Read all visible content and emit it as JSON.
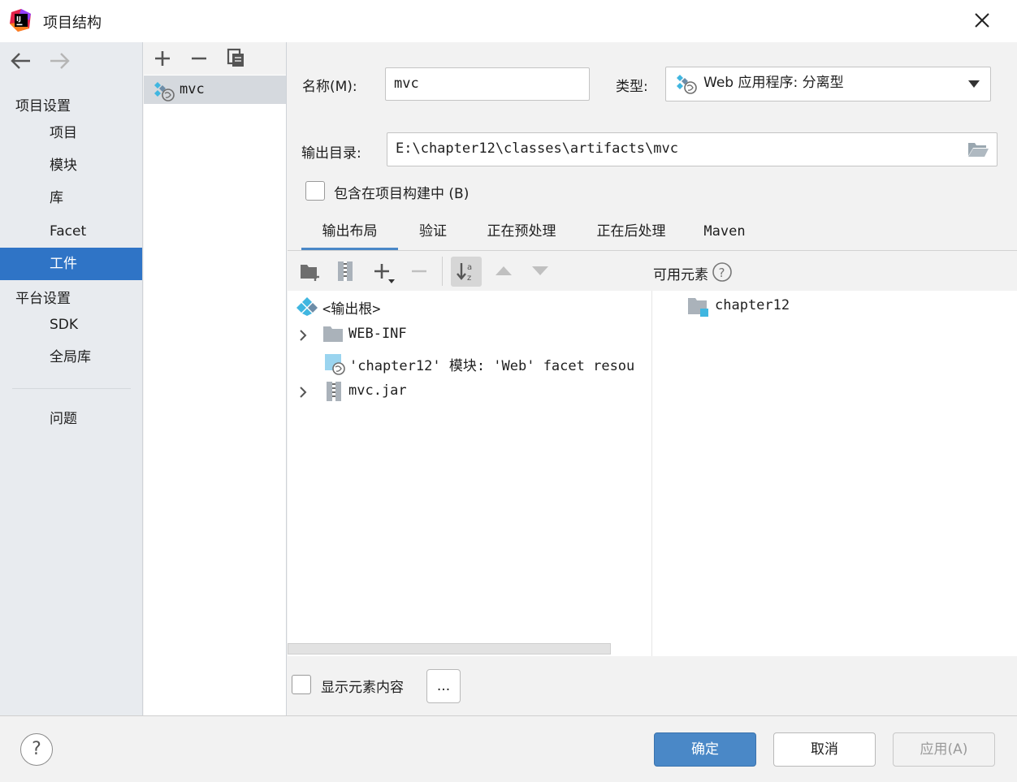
{
  "window": {
    "title": "项目结构"
  },
  "nav": {
    "sections": [
      {
        "label": "项目设置",
        "items": [
          "项目",
          "模块",
          "库",
          "Facet",
          "工件"
        ]
      },
      {
        "label": "平台设置",
        "items": [
          "SDK",
          "全局库"
        ]
      }
    ],
    "problems": "问题",
    "selected": "工件"
  },
  "artifacts": {
    "items": [
      "mvc"
    ]
  },
  "form": {
    "name_label": "名称(M):",
    "name_value": "mvc",
    "type_label": "类型:",
    "type_value": "Web 应用程序: 分离型",
    "output_label": "输出目录:",
    "output_value": "E:\\chapter12\\classes\\artifacts\\mvc",
    "include_label": "包含在项目构建中 (B)",
    "include_checked": false
  },
  "tabs": [
    "输出布局",
    "验证",
    "正在预处理",
    "正在后处理",
    "Maven"
  ],
  "selected_tab": "输出布局",
  "layout": {
    "available_label": "可用元素",
    "tree": [
      {
        "label": "<输出根>"
      },
      {
        "label": "WEB-INF"
      },
      {
        "label": "'chapter12' 模块: 'Web' facet resou"
      },
      {
        "label": "mvc.jar"
      }
    ],
    "available": [
      "chapter12"
    ],
    "show_content_label": "显示元素内容",
    "more_label": "..."
  },
  "buttons": {
    "ok": "确定",
    "cancel": "取消",
    "apply": "应用(A)",
    "help": "?"
  },
  "colors": {
    "accent": "#2f74c6",
    "primary_button": "#4a88c7"
  }
}
